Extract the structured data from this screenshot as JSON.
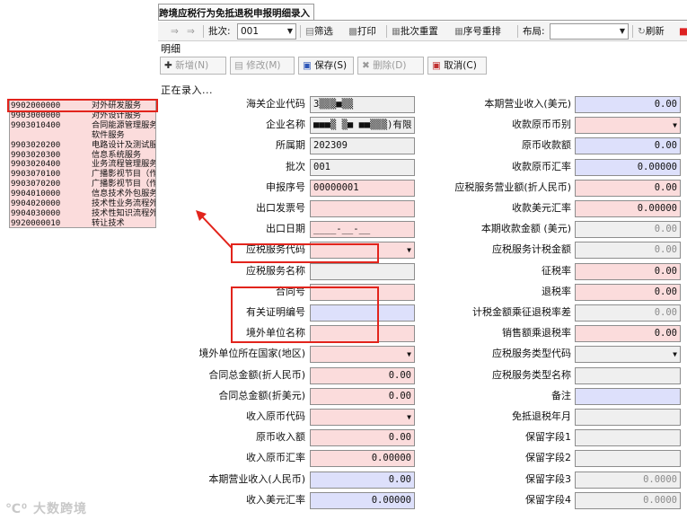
{
  "window": {
    "tab_title": "跨境应税行为免抵退税申报明细录入"
  },
  "toolbar": {
    "batch_label": "批次:",
    "batch_value": "001",
    "filter": "筛选",
    "print": "打印",
    "batch_reset": "批次重置",
    "seq_reorder": "序号重排",
    "layout_label": "布局:",
    "layout_value": "",
    "refresh": "刷新"
  },
  "section_title": "明细",
  "actions": {
    "add": "新增(N)",
    "edit": "修改(M)",
    "save": "保存(S)",
    "delete": "删除(D)",
    "cancel": "取消(C)"
  },
  "status_text": "正在录入...",
  "dropdown_items": [
    {
      "code": "9902000000",
      "name": "对外研发服务"
    },
    {
      "code": "9903000000",
      "name": "对外设计服务"
    },
    {
      "code": "9903010400",
      "name": "合同能源管理服务（合"
    },
    {
      "code": "",
      "name": "软件服务"
    },
    {
      "code": "9903020200",
      "name": "电路设计及测试服务"
    },
    {
      "code": "9903020300",
      "name": "信息系统服务"
    },
    {
      "code": "9903020400",
      "name": "业务流程管理服务"
    },
    {
      "code": "9903070100",
      "name": "广播影视节目（作品）"
    },
    {
      "code": "9903070200",
      "name": "广播影视节目（作品）"
    },
    {
      "code": "9904010000",
      "name": "信息技术外包服务（IT"
    },
    {
      "code": "9904020000",
      "name": "技术性业务流程外包服"
    },
    {
      "code": "9904030000",
      "name": "技术性知识流程外包服"
    },
    {
      "code": "9920000010",
      "name": "转让技术"
    }
  ],
  "form_left": [
    {
      "label": "海关企业代码",
      "value": "3▒▒▒■▒▒",
      "color": "gray"
    },
    {
      "label": "企业名称",
      "value": "■■■▒ ▒■ ■■▒▒▒)有限",
      "color": "gray"
    },
    {
      "label": "所属期",
      "value": "202309",
      "color": "gray"
    },
    {
      "label": "批次",
      "value": "001",
      "color": "gray"
    },
    {
      "label": "申报序号",
      "value": "00000001",
      "color": "pink"
    },
    {
      "label": "出口发票号",
      "value": "",
      "color": "pink"
    },
    {
      "label": "出口日期",
      "value": "____-__-__",
      "color": "pink"
    },
    {
      "label": "应税服务代码",
      "value": "",
      "color": "pink",
      "dropdown": true
    },
    {
      "label": "应税服务名称",
      "value": "",
      "color": "gray"
    },
    {
      "label": "合同号",
      "value": "",
      "color": "pink"
    },
    {
      "label": "有关证明编号",
      "value": "",
      "color": "lav"
    },
    {
      "label": "境外单位名称",
      "value": "",
      "color": "pink"
    },
    {
      "label": "境外单位所在国家(地区)",
      "value": "",
      "color": "pink",
      "dropdown": true
    },
    {
      "label": "合同总金额(折人民币)",
      "value": "0.00",
      "color": "pink",
      "right": true
    },
    {
      "label": "合同总金额(折美元)",
      "value": "0.00",
      "color": "pink",
      "right": true
    },
    {
      "label": "收入原币代码",
      "value": "",
      "color": "pink",
      "dropdown": true
    },
    {
      "label": "原币收入额",
      "value": "0.00",
      "color": "pink",
      "right": true
    },
    {
      "label": "收入原币汇率",
      "value": "0.00000",
      "color": "pink",
      "right": true
    },
    {
      "label": "本期营业收入(人民币)",
      "value": "0.00",
      "color": "lav",
      "right": true
    },
    {
      "label": "收入美元汇率",
      "value": "0.00000",
      "color": "lav",
      "right": true
    }
  ],
  "form_right": [
    {
      "label": "本期营业收入(美元)",
      "value": "0.00",
      "color": "lav",
      "right": true
    },
    {
      "label": "收款原币币别",
      "value": "",
      "color": "pink",
      "dropdown": true
    },
    {
      "label": "原币收款额",
      "value": "0.00",
      "color": "lav",
      "right": true
    },
    {
      "label": "收款原币汇率",
      "value": "0.00000",
      "color": "lav",
      "right": true
    },
    {
      "label": "应税服务营业额(折人民币)",
      "value": "0.00",
      "color": "pink",
      "right": true
    },
    {
      "label": "收款美元汇率",
      "value": "0.00000",
      "color": "pink",
      "right": true
    },
    {
      "label": "本期收款金额 (美元)",
      "value": "0.00",
      "color": "gray",
      "right": true,
      "graytext": true
    },
    {
      "label": "应税服务计税金额",
      "value": "0.00",
      "color": "gray",
      "right": true,
      "graytext": true
    },
    {
      "label": "征税率",
      "value": "0.00",
      "color": "pink",
      "right": true
    },
    {
      "label": "退税率",
      "value": "0.00",
      "color": "pink",
      "right": true
    },
    {
      "label": "计税金额乘征退税率差",
      "value": "0.00",
      "color": "gray",
      "right": true,
      "graytext": true
    },
    {
      "label": "销售额乘退税率",
      "value": "0.00",
      "color": "pink",
      "right": true
    },
    {
      "label": "应税服务类型代码",
      "value": "",
      "color": "gray",
      "dropdown": true
    },
    {
      "label": "应税服务类型名称",
      "value": "",
      "color": "gray"
    },
    {
      "label": "备注",
      "value": "",
      "color": "lav"
    },
    {
      "label": "免抵退税年月",
      "value": "",
      "color": "gray"
    },
    {
      "label": "保留字段1",
      "value": "",
      "color": "gray"
    },
    {
      "label": "保留字段2",
      "value": "",
      "color": "gray"
    },
    {
      "label": "保留字段3",
      "value": "0.0000",
      "color": "gray",
      "right": true,
      "graytext": true
    },
    {
      "label": "保留字段4",
      "value": "0.0000",
      "color": "gray",
      "right": true,
      "graytext": true
    }
  ],
  "watermark": "℃⁰ 大数跨境",
  "colors": {
    "pink": "#fbdcdc",
    "lavender": "#dde0fb",
    "gray": "#efefef",
    "annotation": "#e2241c"
  }
}
